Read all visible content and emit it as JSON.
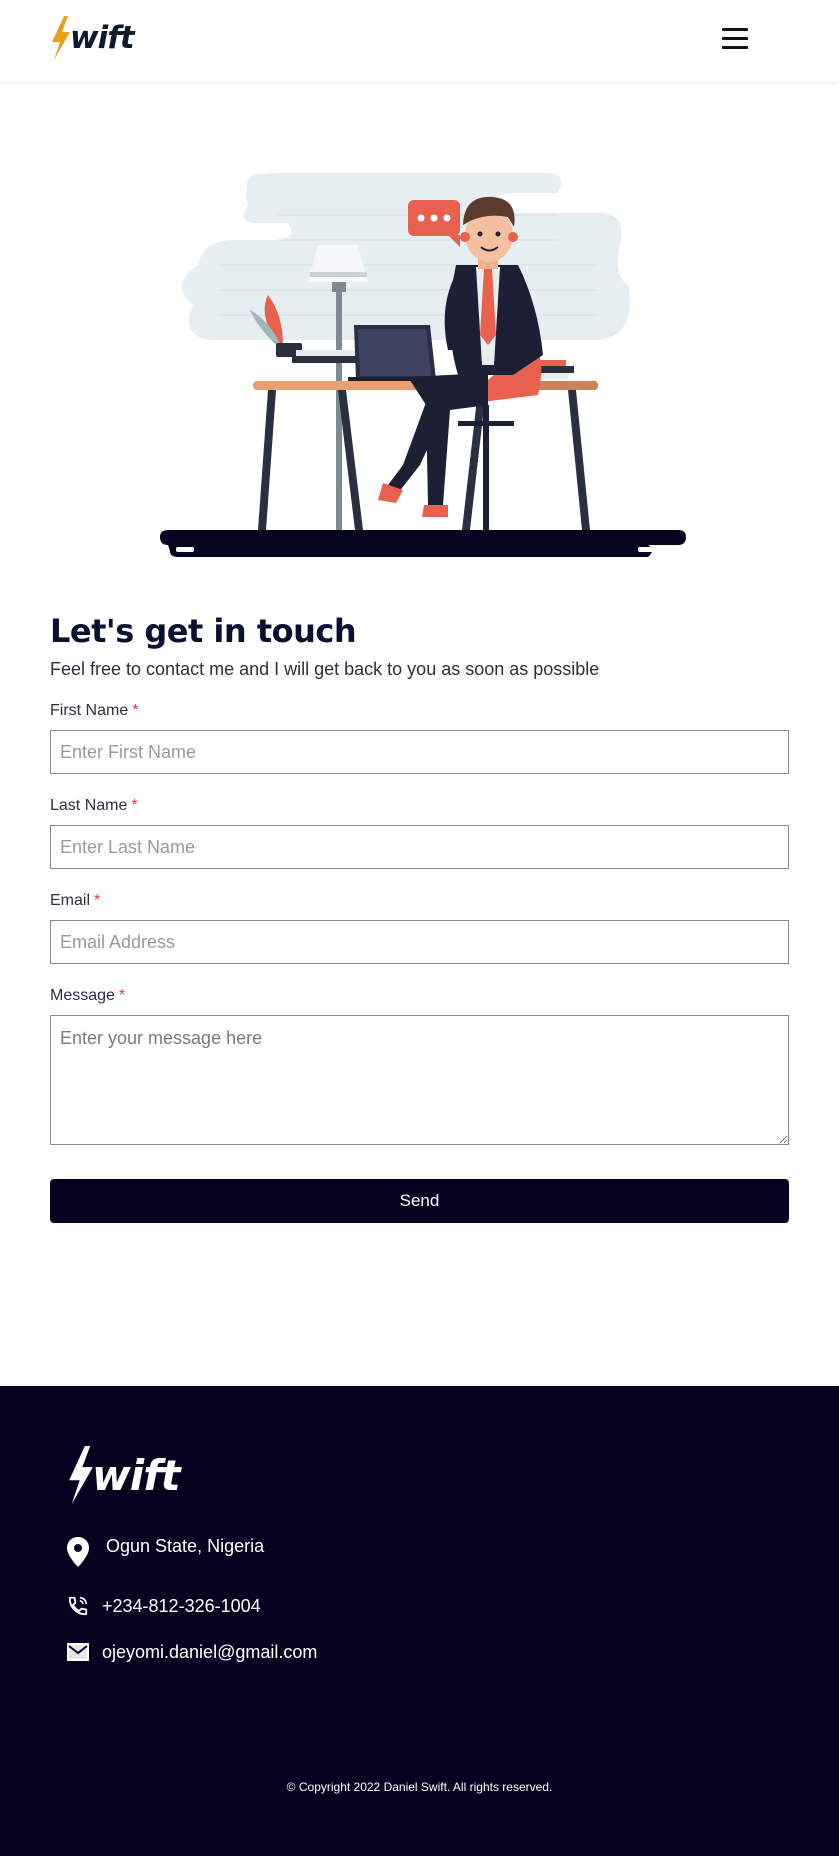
{
  "header": {
    "logo_text": "wift",
    "menu_icon": "hamburger-menu-icon"
  },
  "contact": {
    "title": "Let's get in touch",
    "subtitle": "Feel free to contact me and I will get back to you as soon as possible",
    "required_mark": "*",
    "fields": {
      "first_name": {
        "label": "First Name",
        "placeholder": "Enter First Name",
        "value": ""
      },
      "last_name": {
        "label": "Last Name",
        "placeholder": "Enter Last Name",
        "value": ""
      },
      "email": {
        "label": "Email",
        "placeholder": "Email Address",
        "value": ""
      },
      "message": {
        "label": "Message",
        "placeholder": "Enter your message here",
        "value": ""
      }
    },
    "send_label": "Send"
  },
  "footer": {
    "logo_text": "wift",
    "location": "Ogun State, Nigeria",
    "phone": "+234-812-326-1004",
    "email": "ojeyomi.daniel@gmail.com",
    "copyright": "© Copyright 2022 Daniel Swift. All rights reserved."
  },
  "colors": {
    "brand_dark": "#03031f",
    "logo_bolt": "#e6a21e",
    "required": "#e03b3b",
    "accent_red": "#e8604e"
  }
}
